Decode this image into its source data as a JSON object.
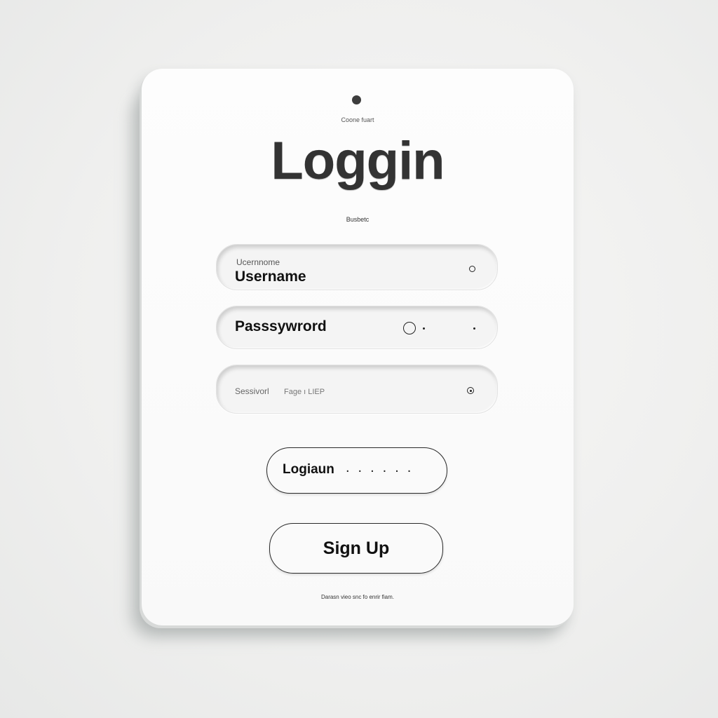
{
  "header": {
    "caption": "Coone fuart",
    "title": "Loggin",
    "subtitle": "Busbetc"
  },
  "form": {
    "username": {
      "placeholder": "Ucernnome",
      "value": "Username",
      "icon": "circle-icon"
    },
    "password": {
      "value": "Passsywrord",
      "icon": "toggle-visibility-icon"
    },
    "session": {
      "label": "Sessivorl",
      "hint": "Fage ı LIEP",
      "icon": "target-icon"
    }
  },
  "buttons": {
    "login_label": "Logiaun",
    "login_dots": "......",
    "signup_label": "Sign Up"
  },
  "footer": {
    "text": "Darasn vieo snc fo enrir fiam."
  },
  "colors": {
    "background": "#efefee",
    "card": "#fbfbfb",
    "text": "#111111",
    "title": "#333333"
  }
}
